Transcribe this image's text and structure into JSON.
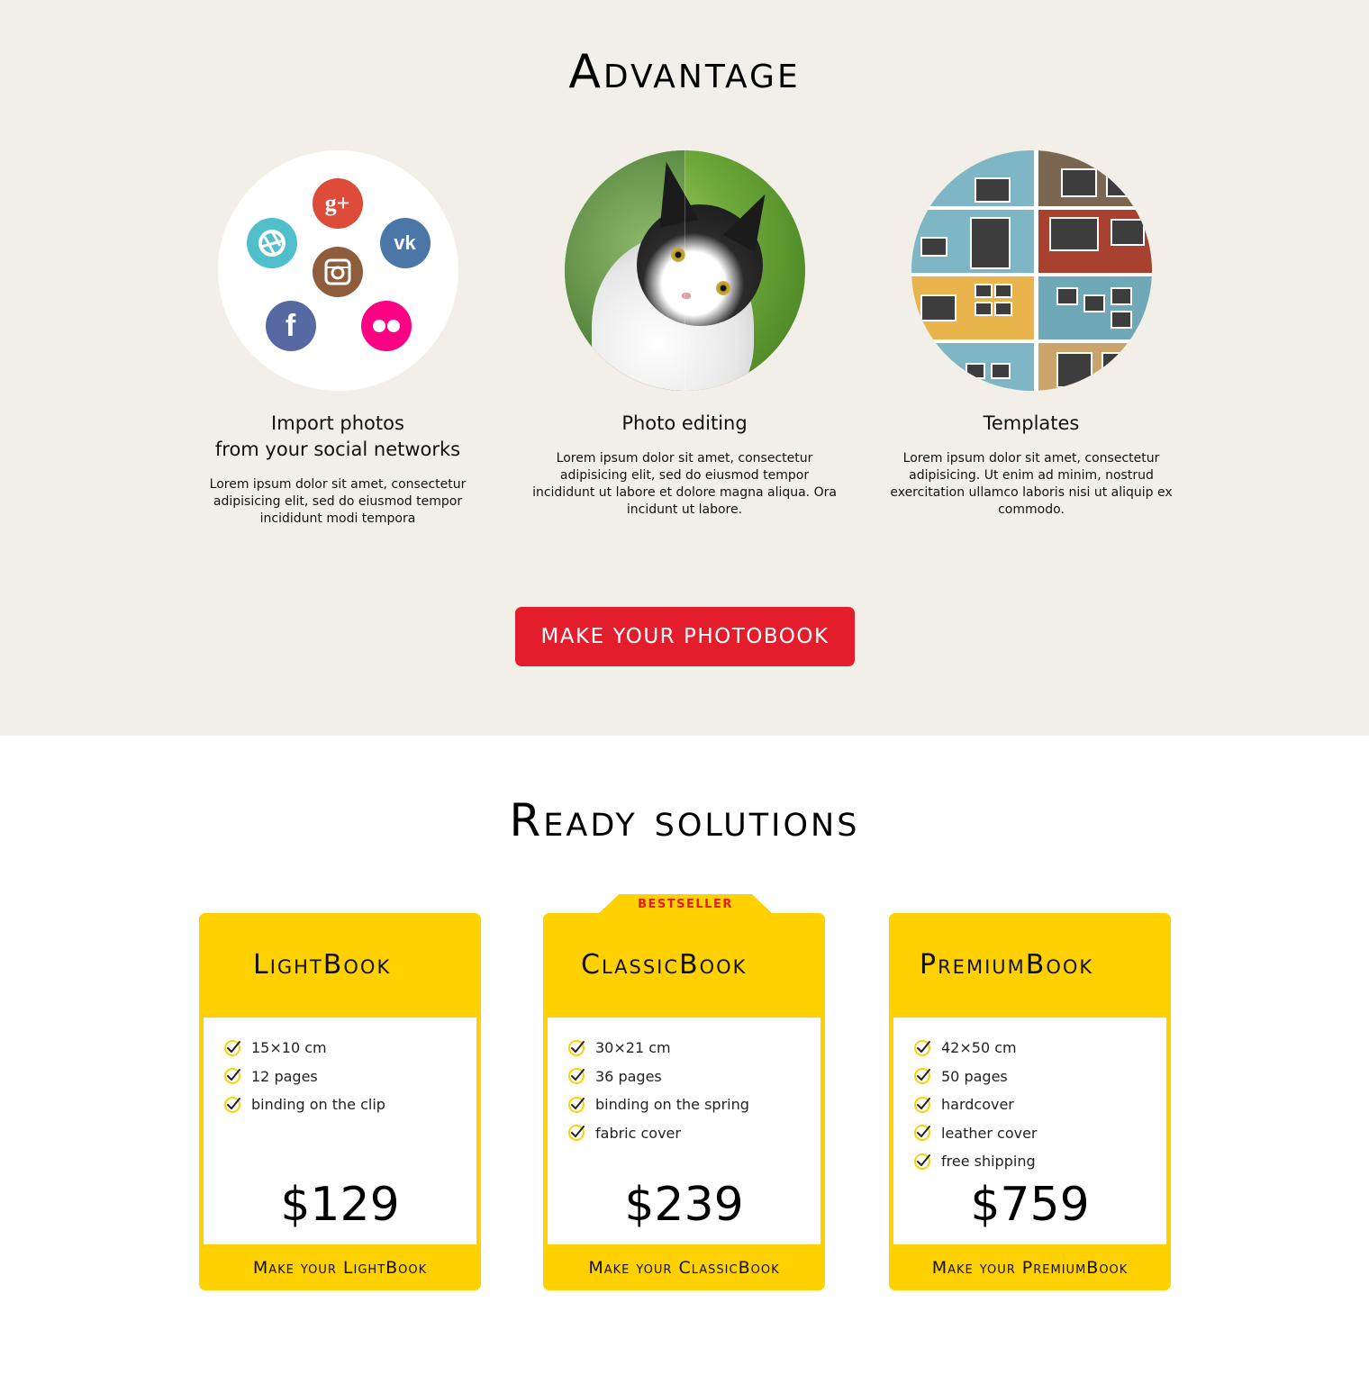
{
  "advantage": {
    "title": "Advantage",
    "features": [
      {
        "title": "Import photos\nfrom your social networks",
        "desc": "Lorem ipsum dolor sit amet, consectetur adipisicing elit, sed do eiusmod tempor incididunt modi tempora",
        "icons": [
          "google-plus-icon",
          "picasa-icon",
          "vk-icon",
          "instagram-icon",
          "facebook-icon",
          "flickr-icon"
        ]
      },
      {
        "title": "Photo editing",
        "desc": "Lorem ipsum dolor sit amet, consectetur adipisicing elit, sed do eiusmod tempor incididunt ut labore et dolore magna aliqua. Ora incidunt ut labore."
      },
      {
        "title": "Templates",
        "desc": "Lorem ipsum dolor sit amet, consectetur adipisicing. Ut enim ad minim, nostrud exercitation ullamco laboris nisi ut aliquip ex commodo."
      }
    ],
    "cta_label": "MAKE YOUR PHOTOBOOK"
  },
  "ready": {
    "title": "Ready solutions",
    "badge": "BESTSELLER",
    "cards": [
      {
        "name": "LightBook",
        "features": [
          "15×10 cm",
          "12 pages",
          "binding on the clip"
        ],
        "price": "$129",
        "button": "Make your LightBook"
      },
      {
        "name": "ClassicBook",
        "features": [
          "30×21 cm",
          "36 pages",
          "binding on the spring",
          "fabric cover"
        ],
        "price": "$239",
        "button": "Make your ClassicBook"
      },
      {
        "name": "PremiumBook",
        "features": [
          "42×50 cm",
          "50 pages",
          "hardcover",
          "leather cover",
          "free shipping"
        ],
        "price": "$759",
        "button": "Make your PremiumBook"
      }
    ]
  },
  "colors": {
    "accent_red": "#e31d2b",
    "card_yellow": "#ffd100",
    "section_bg": "#f2efe8"
  }
}
